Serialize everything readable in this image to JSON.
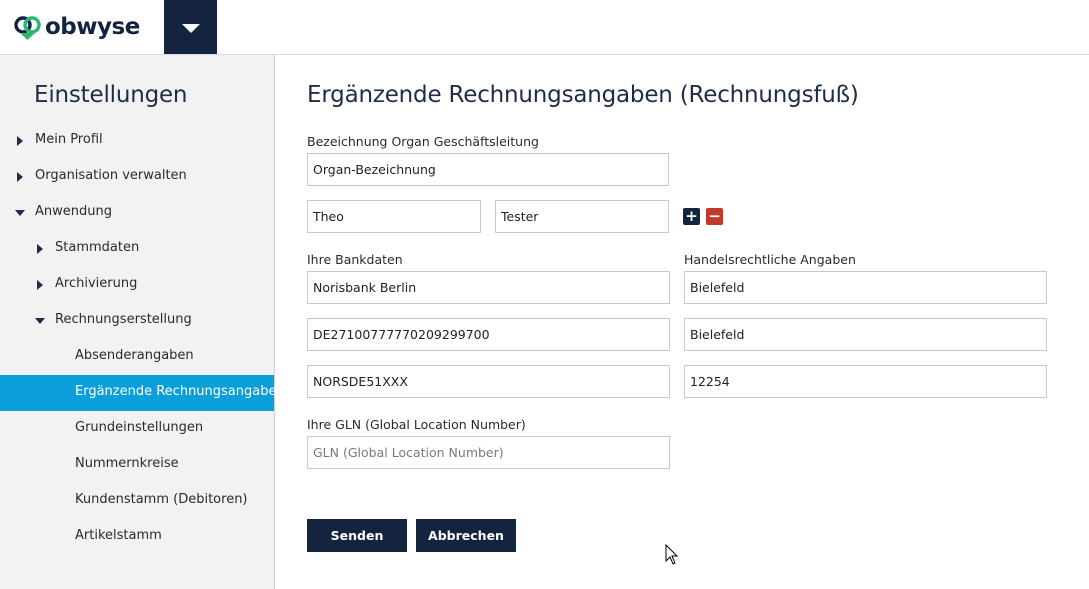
{
  "header": {
    "logo_text": "obwyse",
    "brand_colors": {
      "navy": "#14243f",
      "accent": "#0a9fd8",
      "green": "#2bb673"
    }
  },
  "sidebar": {
    "title": "Einstellungen",
    "items": [
      {
        "label": "Mein Profil",
        "state": "collapsed",
        "level": 0
      },
      {
        "label": "Organisation verwalten",
        "state": "collapsed",
        "level": 0
      },
      {
        "label": "Anwendung",
        "state": "expanded",
        "level": 0
      },
      {
        "label": "Stammdaten",
        "state": "collapsed",
        "level": 1
      },
      {
        "label": "Archivierung",
        "state": "collapsed",
        "level": 1
      },
      {
        "label": "Rechnungserstellung",
        "state": "expanded",
        "level": 1
      },
      {
        "label": "Absenderangaben",
        "state": "leaf",
        "level": 2
      },
      {
        "label": "Ergänzende Rechnungsangaben",
        "state": "active",
        "level": 2
      },
      {
        "label": "Grundeinstellungen",
        "state": "leaf",
        "level": 2
      },
      {
        "label": "Nummernkreise",
        "state": "leaf",
        "level": 2
      },
      {
        "label": "Kundenstamm (Debitoren)",
        "state": "leaf",
        "level": 2
      },
      {
        "label": "Artikelstamm",
        "state": "leaf",
        "level": 2
      }
    ]
  },
  "main": {
    "title": "Ergänzende Rechnungsangaben (Rechnungsfuß)",
    "organ": {
      "label": "Bezeichnung Organ Geschäftsleitung",
      "designation_value": "Organ-Bezeichnung",
      "first_name_value": "Theo",
      "last_name_value": "Tester",
      "add_label": "+",
      "remove_label": "−"
    },
    "bank": {
      "label": "Ihre Bankdaten",
      "bank_name": "Norisbank Berlin",
      "iban": "DE27100777770209299700",
      "bic": "NORSDE51XXX"
    },
    "commercial": {
      "label": "Handelsrechtliche Angaben",
      "field1": "Bielefeld",
      "field2": "Bielefeld",
      "field3": "12254"
    },
    "gln": {
      "label": "Ihre GLN (Global Location Number)",
      "placeholder": "GLN (Global Location Number)",
      "value": ""
    },
    "buttons": {
      "submit": "Senden",
      "cancel": "Abbrechen"
    }
  }
}
